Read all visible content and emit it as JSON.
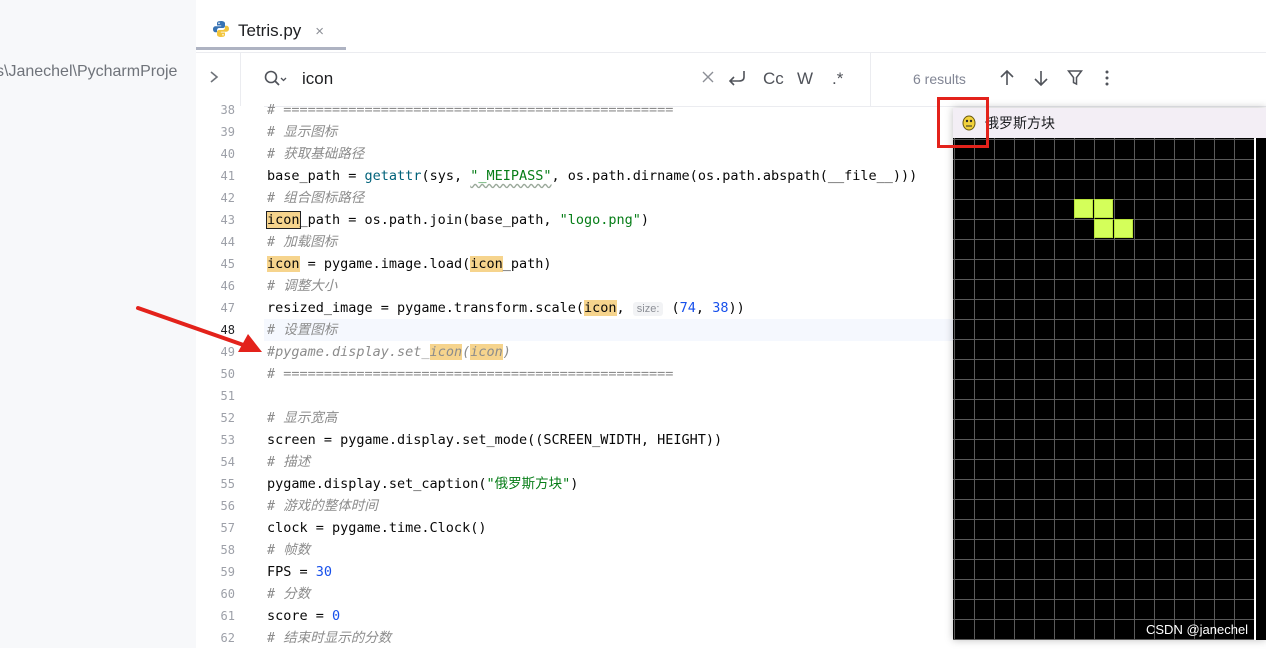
{
  "project_path": "s\\Janechel\\PycharmProje",
  "tab": {
    "label": "Tetris.py",
    "close_glyph": "×"
  },
  "search": {
    "value": "icon",
    "results": "6 results",
    "case_label": "Cc",
    "word_label": "W",
    "regex_label": ".*"
  },
  "line_numbers": [
    "38",
    "39",
    "40",
    "41",
    "42",
    "43",
    "44",
    "45",
    "46",
    "47",
    "48",
    "49",
    "50",
    "51",
    "52",
    "53",
    "54",
    "55",
    "56",
    "57",
    "58",
    "59",
    "60",
    "61",
    "62"
  ],
  "code": {
    "l38": "# ================================================",
    "l39": "# 显示图标",
    "l40": "# 获取基础路径",
    "l41_a": "base_path = ",
    "l41_fn": "getattr",
    "l41_b": "(sys, ",
    "l41_str": "\"_MEIPASS\"",
    "l41_c": ", os.path.dirname(os.path.abspath(__file__)))",
    "l42": "# 组合图标路径",
    "l43_hl": "icon",
    "l43_a": "_path = os.path.join(base_path, ",
    "l43_str": "\"logo.png\"",
    "l43_b": ")",
    "l44": "# 加载图标",
    "l45_hl1": "icon",
    "l45_a": " = pygame.image.load(",
    "l45_hl2": "icon",
    "l45_b": "_path)",
    "l46": "# 调整大小",
    "l47_a": "resized_image = pygame.transform.scale(",
    "l47_hl": "icon",
    "l47_b": ", ",
    "l47_inlay": "size:",
    "l47_c": " (",
    "l47_n1": "74",
    "l47_d": ", ",
    "l47_n2": "38",
    "l47_e": "))",
    "l48": "# 设置图标",
    "l49_a": "#pygame.display.set_",
    "l49_hl1": "icon",
    "l49_b": "(",
    "l49_hl2": "icon",
    "l49_c": ")",
    "l50": "# ================================================",
    "l52": "# 显示宽高",
    "l53": "screen = pygame.display.set_mode((SCREEN_WIDTH, HEIGHT))",
    "l54": "# 描述",
    "l55_a": "pygame.display.set_caption(",
    "l55_str": "\"俄罗斯方块\"",
    "l55_b": ")",
    "l56": "# 游戏的整体时间",
    "l57": "clock = pygame.time.Clock()",
    "l58": "# 帧数",
    "l59_a": "FPS = ",
    "l59_n": "30",
    "l60": "# 分数",
    "l61_a": "score = ",
    "l61_n": "0",
    "l62": "# 结束时显示的分数"
  },
  "game_window": {
    "title": "俄罗斯方块",
    "block_color": "#d4ff5a"
  },
  "watermark": "CSDN @janechel",
  "colors": {
    "annotation_red": "#e3221b",
    "highlight": "#f6d48d"
  }
}
